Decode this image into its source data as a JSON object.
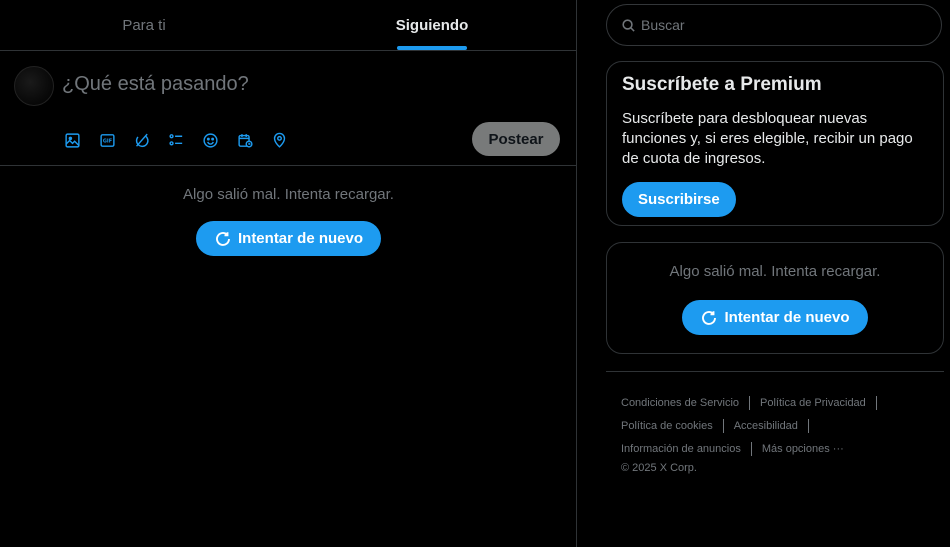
{
  "tabs": [
    {
      "label": "Para ti",
      "active": false
    },
    {
      "label": "Siguiendo",
      "active": true
    }
  ],
  "composer": {
    "placeholder": "¿Qué está pasando?",
    "post_label": "Postear",
    "tools": [
      "image-icon",
      "gif-icon",
      "grok-icon",
      "poll-icon",
      "emoji-icon",
      "schedule-icon",
      "location-icon"
    ]
  },
  "main_error": {
    "message": "Algo salió mal. Intenta recargar.",
    "retry_label": "Intentar de nuevo"
  },
  "search": {
    "placeholder": "Buscar"
  },
  "premium": {
    "title": "Suscríbete a Premium",
    "body": "Suscríbete para desbloquear nuevas funciones y, si eres elegible, recibir un pago de cuota de ingresos.",
    "button_label": "Suscribirse"
  },
  "sidebar_error": {
    "message": "Algo salió mal. Intenta recargar.",
    "retry_label": "Intentar de nuevo"
  },
  "footer": {
    "rows": [
      [
        "Condiciones de Servicio",
        "Política de Privacidad"
      ],
      [
        "Política de cookies",
        "Accesibilidad"
      ],
      [
        "Información de anuncios",
        "Más opciones ···"
      ]
    ],
    "copyright": "© 2025 X Corp."
  },
  "colors": {
    "accent": "#1d9bf0",
    "border": "#2f3336",
    "muted": "#71767b",
    "text": "#e7e9ea"
  }
}
